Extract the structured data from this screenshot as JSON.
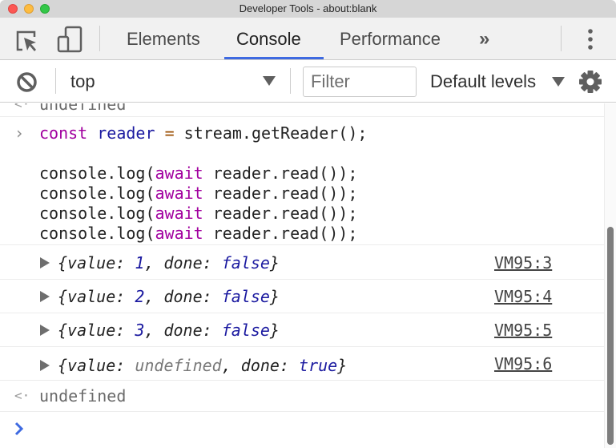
{
  "window": {
    "title": "Developer Tools - about:blank"
  },
  "tabbar": {
    "tabs": [
      {
        "label": "Elements",
        "active": false
      },
      {
        "label": "Console",
        "active": true
      },
      {
        "label": "Performance",
        "active": false
      }
    ],
    "more_tabs_label": "»",
    "accent_color": "#3e6ae1"
  },
  "toolbar": {
    "context": "top",
    "filter_placeholder": "Filter",
    "levels_label": "Default levels"
  },
  "console": {
    "prev_result": "undefined",
    "input": {
      "line1": {
        "kw": "const",
        "var": "reader",
        "op": "=",
        "rest": " stream.getReader();"
      },
      "log_lines": [
        {
          "pre": "console.log(",
          "kw": "await",
          "post": " reader.read());"
        },
        {
          "pre": "console.log(",
          "kw": "await",
          "post": " reader.read());"
        },
        {
          "pre": "console.log(",
          "kw": "await",
          "post": " reader.read());"
        },
        {
          "pre": "console.log(",
          "kw": "await",
          "post": " reader.read());"
        }
      ]
    },
    "outputs": [
      {
        "open": "{value: ",
        "value": "1",
        "mid": ", done: ",
        "done": "false",
        "close": "}",
        "source": "VM95:3"
      },
      {
        "open": "{value: ",
        "value": "2",
        "mid": ", done: ",
        "done": "false",
        "close": "}",
        "source": "VM95:4"
      },
      {
        "open": "{value: ",
        "value": "3",
        "mid": ", done: ",
        "done": "false",
        "close": "}",
        "source": "VM95:5"
      },
      {
        "open": "{value: ",
        "value": "undefined",
        "mid": ", done: ",
        "done": "true",
        "close": "}",
        "source": "VM95:6"
      }
    ],
    "result": "undefined"
  }
}
